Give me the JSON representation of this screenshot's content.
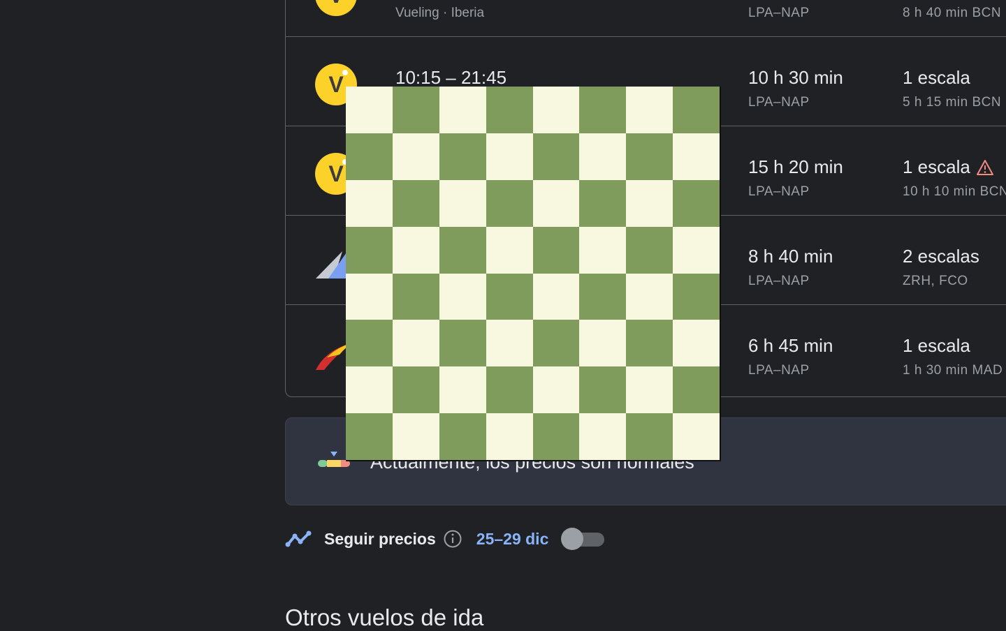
{
  "flights": [
    {
      "times": "",
      "airline": "Vueling · Iberia",
      "duration": "",
      "route": "LPA–NAP",
      "stops": "",
      "stop_detail": "8 h 40 min BCN",
      "logo": "vueling-logo",
      "warning": false
    },
    {
      "times": "10:15 – 21:45",
      "airline": "",
      "duration": "10 h 30 min",
      "route": "LPA–NAP",
      "stops": "1 escala",
      "stop_detail": "5 h 15 min BCN",
      "logo": "vueling-logo",
      "warning": false
    },
    {
      "times": "",
      "airline": "",
      "duration": "15 h 20 min",
      "route": "LPA–NAP",
      "stops": "1 escala",
      "stop_detail": "10 h 10 min BCN",
      "logo": "vueling-logo",
      "warning": true
    },
    {
      "times": "",
      "airline": "",
      "duration": "8 h 40 min",
      "route": "LPA–NAP",
      "stops": "2 escalas",
      "stop_detail": "ZRH, FCO",
      "logo": "multi-airline-logo",
      "warning": false
    },
    {
      "times": "",
      "airline": "",
      "duration": "6 h 45 min",
      "route": "LPA–NAP",
      "stops": "1 escala",
      "stop_detail": "1 h 30 min MAD",
      "logo": "iberia-logo",
      "warning": false
    }
  ],
  "price_insight": {
    "text": "Actualmente, los precios son normales",
    "icon": "price-gauge-icon"
  },
  "track_prices": {
    "label": "Seguir precios",
    "dates": "25–29 dic",
    "enabled": false,
    "icon": "trend-line-icon"
  },
  "other_flights": {
    "title": "Otros vuelos de ida"
  },
  "overlay": {
    "type": "checkerboard",
    "rows": 8,
    "cols": 8,
    "light_color": "#f8f8e0",
    "dark_color": "#7f9c5c"
  },
  "colors": {
    "background": "#202124",
    "accent": "#8ab4f8",
    "vueling_yellow": "#fcd12a",
    "warning": "#f28b82"
  }
}
